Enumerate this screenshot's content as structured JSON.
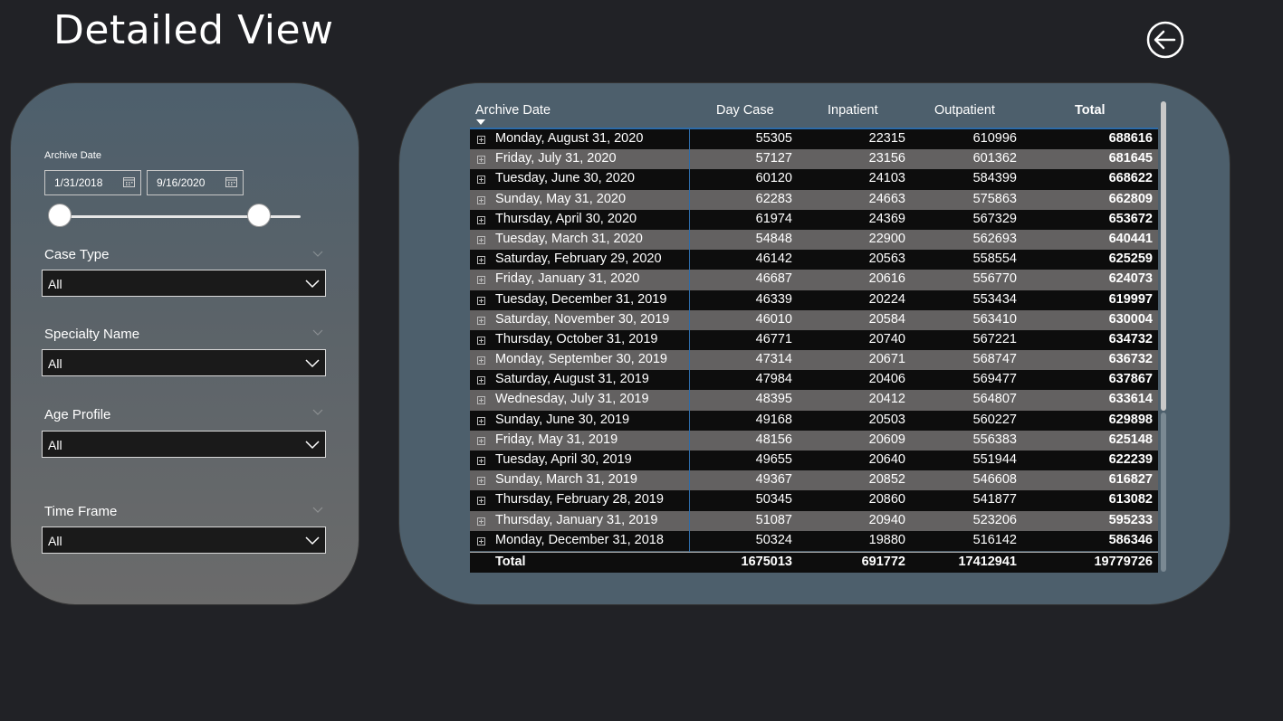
{
  "page": {
    "title": "Detailed View",
    "back_icon": "arrow-left-circle-icon"
  },
  "filters": {
    "archive_date": {
      "label": "Archive Date",
      "start": "1/31/2018",
      "end": "9/16/2020"
    },
    "case_type": {
      "label": "Case Type",
      "value": "All"
    },
    "specialty_name": {
      "label": "Specialty Name",
      "value": "All"
    },
    "age_profile": {
      "label": "Age Profile",
      "value": "All"
    },
    "time_frame": {
      "label": "Time Frame",
      "value": "All"
    }
  },
  "table": {
    "columns": [
      "Archive Date",
      "Day Case",
      "Inpatient",
      "Outpatient",
      "Total"
    ],
    "rows": [
      [
        "Monday, August 31, 2020",
        "55305",
        "22315",
        "610996",
        "688616"
      ],
      [
        "Friday, July 31, 2020",
        "57127",
        "23156",
        "601362",
        "681645"
      ],
      [
        "Tuesday, June 30, 2020",
        "60120",
        "24103",
        "584399",
        "668622"
      ],
      [
        "Sunday, May 31, 2020",
        "62283",
        "24663",
        "575863",
        "662809"
      ],
      [
        "Thursday, April 30, 2020",
        "61974",
        "24369",
        "567329",
        "653672"
      ],
      [
        "Tuesday, March 31, 2020",
        "54848",
        "22900",
        "562693",
        "640441"
      ],
      [
        "Saturday, February 29, 2020",
        "46142",
        "20563",
        "558554",
        "625259"
      ],
      [
        "Friday, January 31, 2020",
        "46687",
        "20616",
        "556770",
        "624073"
      ],
      [
        "Tuesday, December 31, 2019",
        "46339",
        "20224",
        "553434",
        "619997"
      ],
      [
        "Saturday, November 30, 2019",
        "46010",
        "20584",
        "563410",
        "630004"
      ],
      [
        "Thursday, October 31, 2019",
        "46771",
        "20740",
        "567221",
        "634732"
      ],
      [
        "Monday, September 30, 2019",
        "47314",
        "20671",
        "568747",
        "636732"
      ],
      [
        "Saturday, August 31, 2019",
        "47984",
        "20406",
        "569477",
        "637867"
      ],
      [
        "Wednesday, July 31, 2019",
        "48395",
        "20412",
        "564807",
        "633614"
      ],
      [
        "Sunday, June 30, 2019",
        "49168",
        "20503",
        "560227",
        "629898"
      ],
      [
        "Friday, May 31, 2019",
        "48156",
        "20609",
        "556383",
        "625148"
      ],
      [
        "Tuesday, April 30, 2019",
        "49655",
        "20640",
        "551944",
        "622239"
      ],
      [
        "Sunday, March 31, 2019",
        "49367",
        "20852",
        "546608",
        "616827"
      ],
      [
        "Thursday, February 28, 2019",
        "50345",
        "20860",
        "541877",
        "613082"
      ],
      [
        "Thursday, January 31, 2019",
        "51087",
        "20940",
        "523206",
        "595233"
      ],
      [
        "Monday, December 31, 2018",
        "50324",
        "19880",
        "516142",
        "586346"
      ]
    ],
    "totals": {
      "label": "Total",
      "day_case": "1675013",
      "inpatient": "691772",
      "outpatient": "17412941",
      "total": "19779726"
    }
  }
}
